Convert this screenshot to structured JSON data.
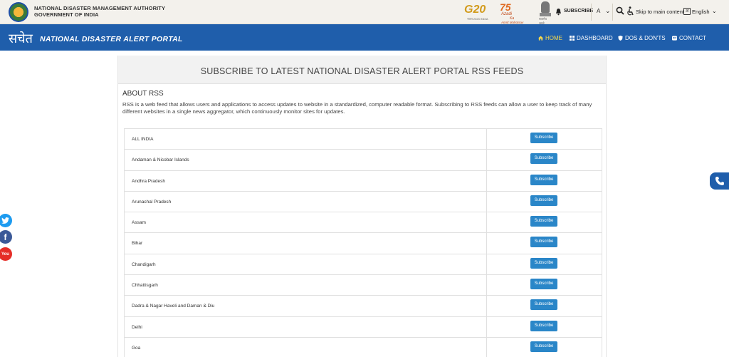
{
  "topbar": {
    "org_line1": "NATIONAL DISASTER MANAGEMENT AUTHORITY",
    "org_line2": "GOVERNMENT OF INDIA",
    "g20_text": "G20",
    "g20_sub": "भारत 2023 INDIA",
    "azadi_num": "75",
    "azadi_text_1": "Azadi",
    "azadi_text_2": "Ka",
    "azadi_text_3": "Amrit Mahotsav",
    "emblem_text": "सत्यमेव जयते",
    "subscribe": "SUBSCRIBE",
    "font_size": "A",
    "skip": "Skip to main content",
    "language": "English"
  },
  "nav": {
    "brand_hi": "सचेत",
    "brand_en": "NATIONAL DISASTER ALERT PORTAL",
    "items": [
      {
        "label": "HOME",
        "icon": "home-icon"
      },
      {
        "label": "DASHBOARD",
        "icon": "grid-icon"
      },
      {
        "label": "DOS & DON'TS",
        "icon": "shield-icon"
      },
      {
        "label": "CONTACT",
        "icon": "contact-icon"
      }
    ]
  },
  "main": {
    "title": "SUBSCRIBE TO LATEST NATIONAL DISASTER ALERT PORTAL RSS FEEDS",
    "about_heading": "ABOUT RSS",
    "about_text": "RSS is a web feed that allows users and applications to access updates to website in a standardized, computer readable format. Subscribing to RSS feeds can allow a user to keep track of many different websites in a single news aggregator, which continuously monitor sites for updates.",
    "subscribe_label": "Subscribe",
    "feeds": [
      "ALL INDIA",
      "Andaman & Nicobar Islands",
      "Andhra Pradesh",
      "Arunachal Pradesh",
      "Assam",
      "Bihar",
      "Chandigarh",
      "Chhattisgarh",
      "Dadra & Nagar Haveli and Daman & Diu",
      "Delhi",
      "Goa"
    ]
  },
  "social": {
    "twitter": "twitter-icon",
    "facebook": "facebook-icon",
    "youtube": "youtube-icon",
    "fb_glyph": "f",
    "yt_glyph": "You"
  },
  "colors": {
    "nav_bg": "#1f5eab",
    "button": "#2a86c8",
    "active_nav": "#f7d94c"
  }
}
